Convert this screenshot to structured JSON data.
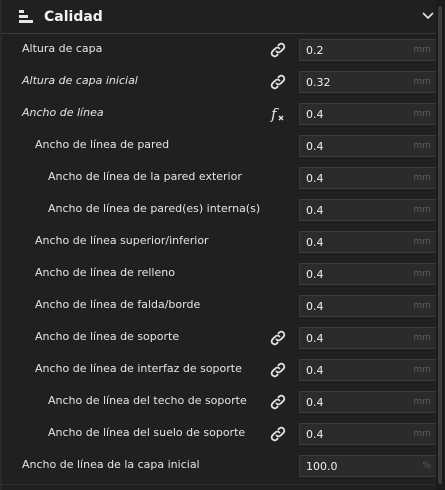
{
  "section": {
    "title": "Calidad",
    "icon": "sliders-icon",
    "collapse_icon": "chevron-down-icon"
  },
  "settings": [
    {
      "label": "Altura de capa",
      "value": "0.2",
      "unit": "mm",
      "icon": "link-icon",
      "italic": false
    },
    {
      "label": "Altura de capa inicial",
      "value": "0.32",
      "unit": "mm",
      "icon": "link-icon",
      "italic": true
    },
    {
      "label": "Ancho de línea",
      "value": "0.4",
      "unit": "mm",
      "icon": "function-icon",
      "italic": true
    },
    {
      "label": "Ancho de línea de pared",
      "value": "0.4",
      "unit": "mm",
      "icon": "",
      "italic": false
    },
    {
      "label": "Ancho de línea de la pared exterior",
      "value": "0.4",
      "unit": "mm",
      "icon": "",
      "italic": false
    },
    {
      "label": "Ancho de línea de pared(es) interna(s)",
      "value": "0.4",
      "unit": "mm",
      "icon": "",
      "italic": false
    },
    {
      "label": "Ancho de línea superior/inferior",
      "value": "0.4",
      "unit": "mm",
      "icon": "",
      "italic": false
    },
    {
      "label": "Ancho de línea de relleno",
      "value": "0.4",
      "unit": "mm",
      "icon": "",
      "italic": false
    },
    {
      "label": "Ancho de línea de falda/borde",
      "value": "0.4",
      "unit": "mm",
      "icon": "",
      "italic": false
    },
    {
      "label": "Ancho de línea de soporte",
      "value": "0.4",
      "unit": "mm",
      "icon": "link-icon",
      "italic": false
    },
    {
      "label": "Ancho de línea de interfaz de soporte",
      "value": "0.4",
      "unit": "mm",
      "icon": "link-icon",
      "italic": false
    },
    {
      "label": "Ancho de línea del techo de soporte",
      "value": "0.4",
      "unit": "mm",
      "icon": "link-icon",
      "italic": false
    },
    {
      "label": "Ancho de línea del suelo de soporte",
      "value": "0.4",
      "unit": "mm",
      "icon": "link-icon",
      "italic": false
    },
    {
      "label": "Ancho de línea de la capa inicial",
      "value": "100.0",
      "unit": "%",
      "icon": "",
      "italic": false
    }
  ]
}
